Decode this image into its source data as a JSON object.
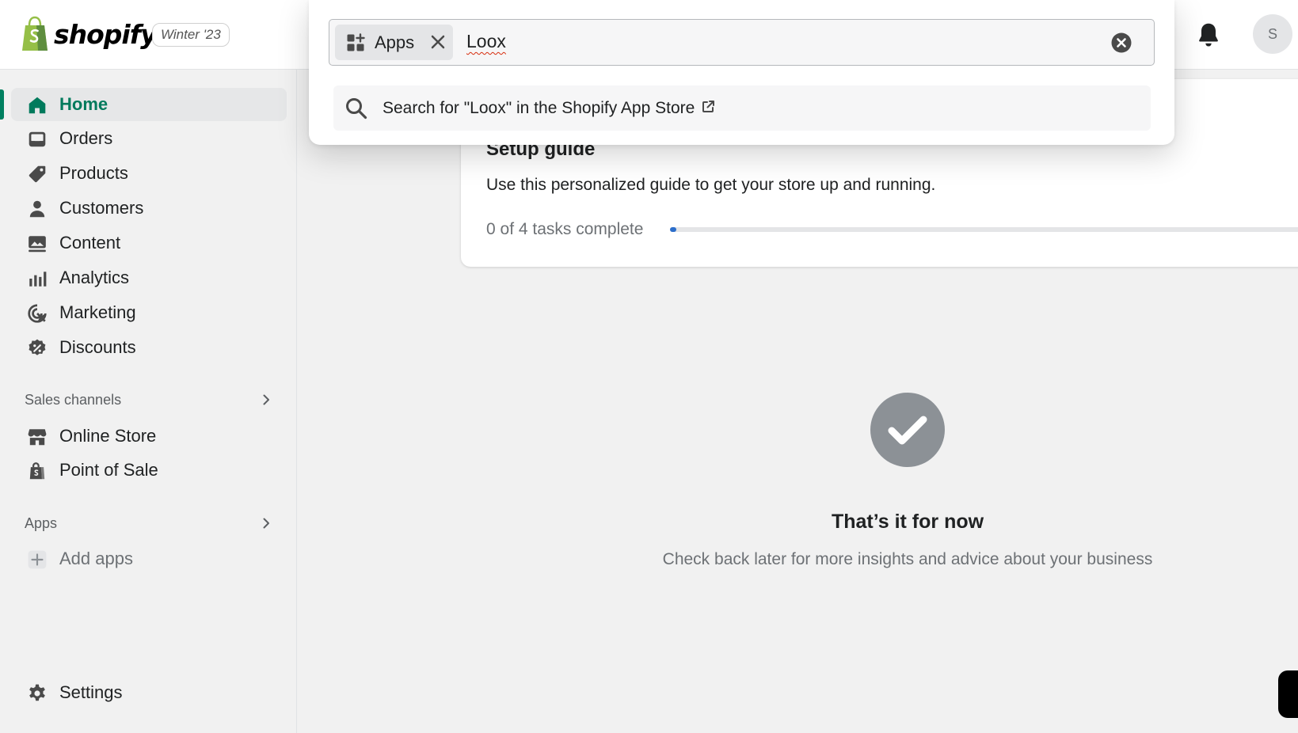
{
  "brand": {
    "name": "shopify",
    "version": "Winter '23"
  },
  "header": {
    "avatar_initial": "S"
  },
  "search": {
    "scope": "Apps",
    "query": "Loox",
    "result_text": "Search for \"Loox\" in the Shopify App Store"
  },
  "sidebar": {
    "items": [
      {
        "label": "Home"
      },
      {
        "label": "Orders"
      },
      {
        "label": "Products"
      },
      {
        "label": "Customers"
      },
      {
        "label": "Content"
      },
      {
        "label": "Analytics"
      },
      {
        "label": "Marketing"
      },
      {
        "label": "Discounts"
      }
    ],
    "sales_channels": {
      "label": "Sales channels",
      "items": [
        {
          "label": "Online Store"
        },
        {
          "label": "Point of Sale"
        }
      ]
    },
    "apps": {
      "label": "Apps",
      "add_label": "Add apps"
    },
    "settings_label": "Settings"
  },
  "setup_guide": {
    "title": "Setup guide",
    "description": "Use this personalized guide to get your store up and running.",
    "progress_text": "0 of 4 tasks complete",
    "progress_fraction": 0.01
  },
  "empty_state": {
    "title": "That’s it for now",
    "subtitle": "Check back later for more insights and advice about your business"
  },
  "colors": {
    "accent": "#008060",
    "active_text": "#007a5c",
    "progress": "#2c6ecb",
    "error_underline": "#d72c0d"
  },
  "icons": {
    "home": "home-icon",
    "orders": "inbox-icon",
    "products": "tag-icon",
    "customers": "person-icon",
    "content": "image-icon",
    "analytics": "bar-chart-icon",
    "marketing": "target-icon",
    "discounts": "discount-icon",
    "online_store": "store-icon",
    "point_of_sale": "bag-icon",
    "add_apps": "plus-icon",
    "settings": "gear-icon",
    "notifications": "bell-icon",
    "search": "search-icon",
    "external": "external-link-icon"
  }
}
